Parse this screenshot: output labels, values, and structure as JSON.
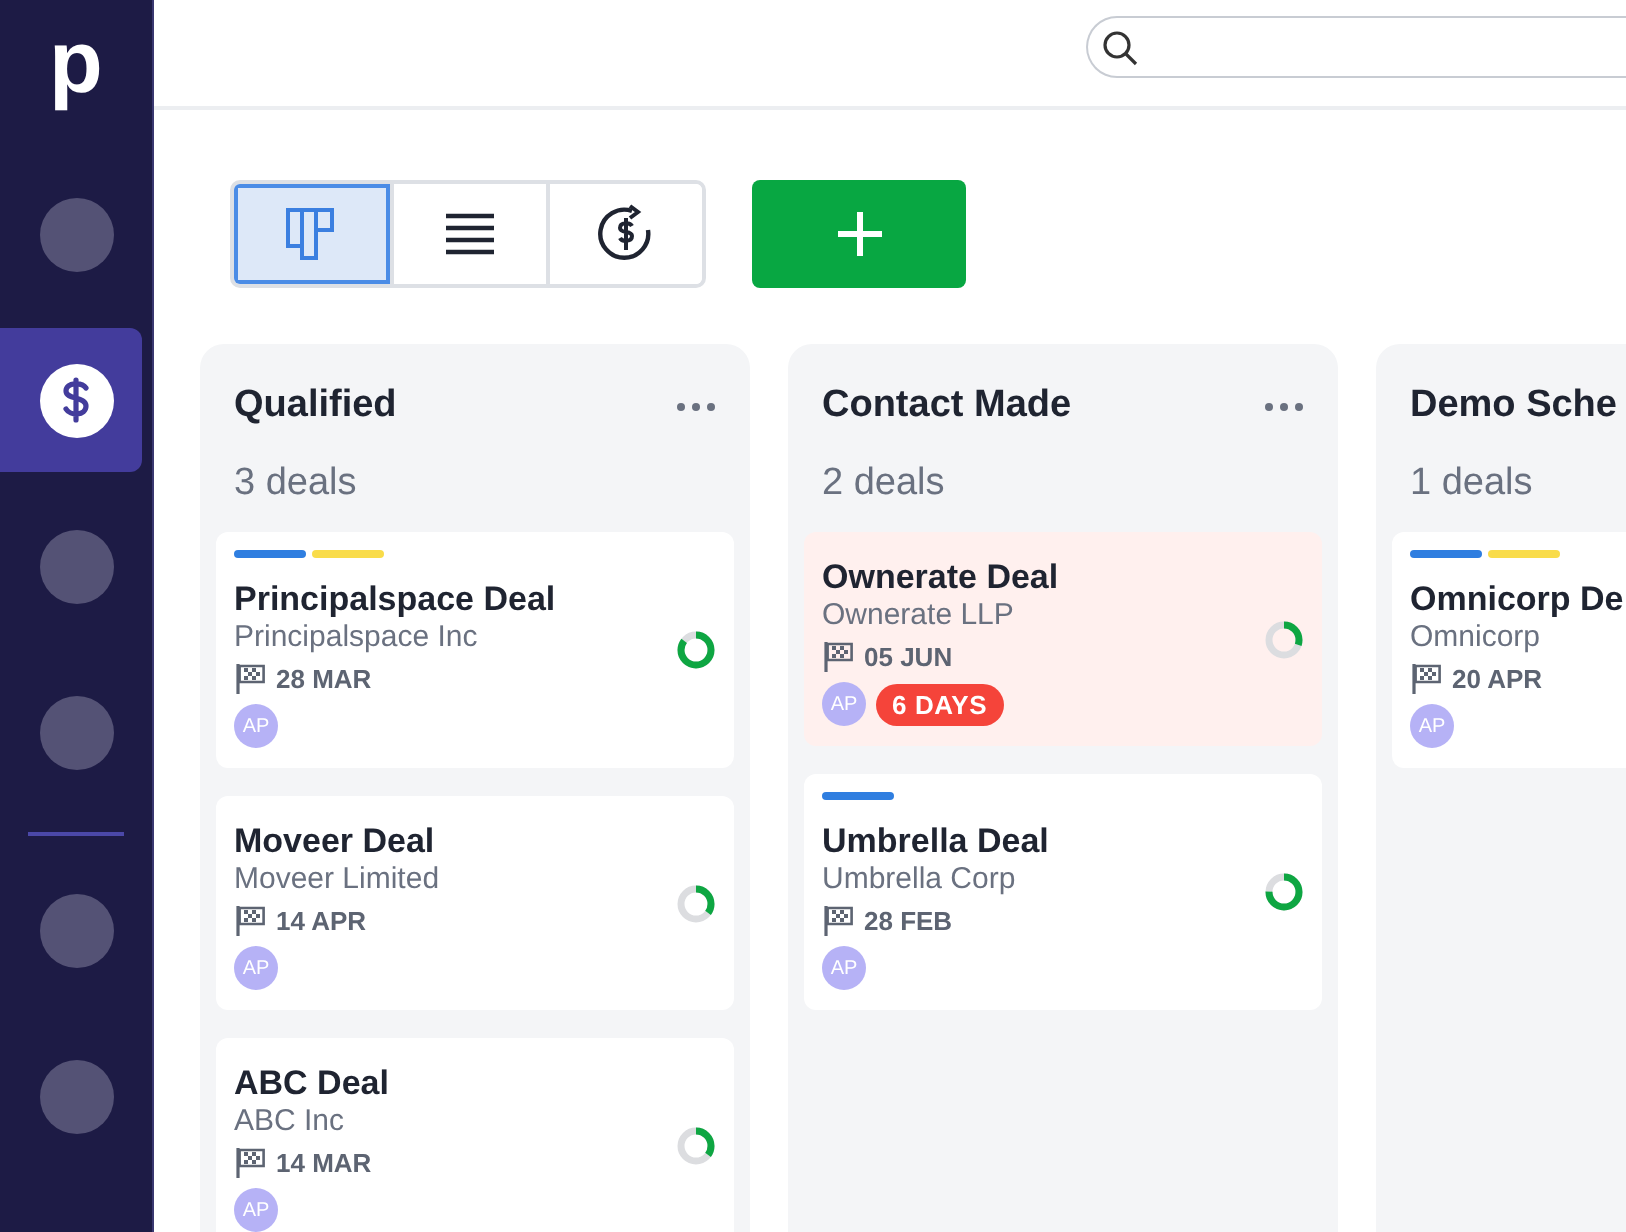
{
  "sidebar": {
    "logo": "p",
    "items": [
      {
        "selected": false
      },
      {
        "selected": true
      },
      {
        "selected": false
      },
      {
        "selected": false
      },
      {
        "selected": false
      },
      {
        "selected": false
      }
    ]
  },
  "view_toggles": [
    {
      "kind": "board",
      "selected": true
    },
    {
      "kind": "list",
      "selected": false
    },
    {
      "kind": "forecast",
      "selected": false
    }
  ],
  "columns": [
    {
      "title": "Qualified",
      "count": "3 deals",
      "menu": true,
      "deals": [
        {
          "title": "Principalspace Deal",
          "company": "Principalspace Inc",
          "date": "28 MAR",
          "owner": "AP",
          "tags": [
            {
              "color": "#2f7ee0"
            },
            {
              "color": "#f9dc4a"
            }
          ],
          "level": 0.85,
          "rotten": false
        },
        {
          "title": "Moveer Deal",
          "company": "Moveer Limited",
          "date": "14 APR",
          "owner": "AP",
          "level": 0.35,
          "rotten": false
        },
        {
          "title": "ABC Deal",
          "company": "ABC Inc",
          "date": "14 MAR",
          "owner": "AP",
          "level": 0.35,
          "rotten": false
        }
      ]
    },
    {
      "title": "Contact Made",
      "count": "2 deals",
      "menu": true,
      "deals": [
        {
          "title": "Ownerate Deal",
          "company": "Ownerate LLP",
          "date": "05 JUN",
          "owner": "AP",
          "level": 0.3,
          "rotten": true,
          "badge": "6 DAYS"
        },
        {
          "title": "Umbrella Deal",
          "company": "Umbrella Corp",
          "date": "28 FEB",
          "owner": "AP",
          "tags": [
            {
              "color": "#2f7ee0"
            }
          ],
          "level": 0.75,
          "rotten": false
        }
      ]
    },
    {
      "title": "Demo Sche",
      "count": "1 deals",
      "menu": false,
      "deals": [
        {
          "title": "Omnicorp De",
          "company": "Omnicorp",
          "date": "20 APR",
          "owner": "AP",
          "tags": [
            {
              "color": "#2f7ee0"
            },
            {
              "color": "#f9dc4a"
            }
          ],
          "rotten": false
        }
      ]
    }
  ]
}
